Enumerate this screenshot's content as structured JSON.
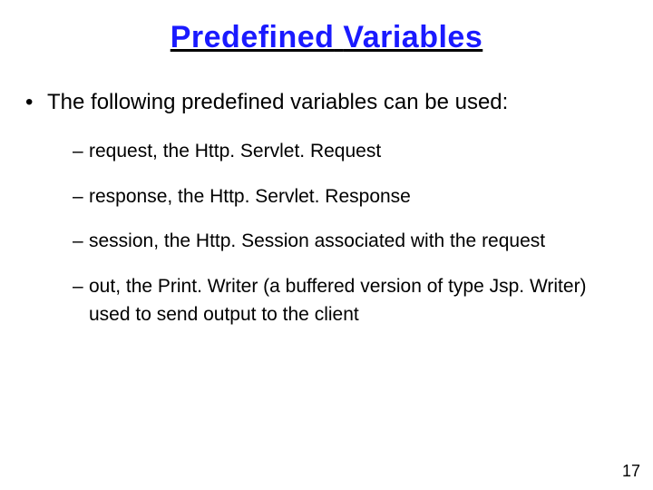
{
  "title": {
    "word1": "Predefined",
    "word2": "Variables"
  },
  "intro": "The following predefined variables can be used:",
  "items": [
    "request, the Http. Servlet. Request",
    "response, the Http. Servlet. Response",
    "session, the Http. Session associated with the request",
    "out, the Print. Writer (a buffered version of type Jsp. Writer) used to send output to the client"
  ],
  "page_number": "17"
}
